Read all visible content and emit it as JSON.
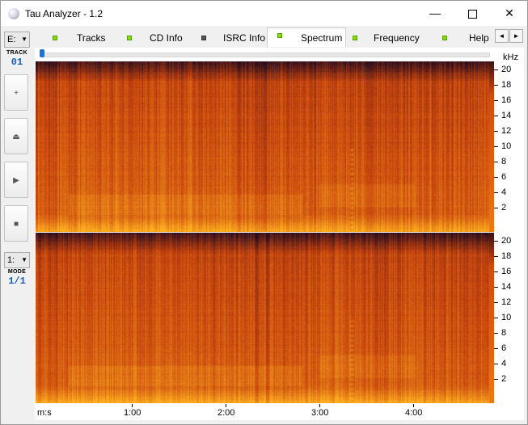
{
  "window": {
    "title": "Tau Analyzer - 1.2",
    "controls": {
      "minimize": "—",
      "close": "✕"
    }
  },
  "left_panel": {
    "drive": "E:",
    "track_caption": "TRACK",
    "track_number": "01",
    "buttons": [
      {
        "name": "zoom-in-button",
        "glyph": "plus-icon",
        "symbol": "+"
      },
      {
        "name": "eject-button",
        "glyph": "eject-icon",
        "symbol": "⏏"
      },
      {
        "name": "play-button",
        "glyph": "play-icon",
        "symbol": "▶"
      },
      {
        "name": "stop-button",
        "glyph": "stop-icon",
        "symbol": "■"
      }
    ],
    "mode_select": "1:",
    "mode_caption": "MODE",
    "mode_value": "1/1"
  },
  "tabs": [
    {
      "label": "Tracks",
      "led": "green",
      "active": false
    },
    {
      "label": "CD Info",
      "led": "green",
      "active": false
    },
    {
      "label": "ISRC Info",
      "led": "dark",
      "active": false
    },
    {
      "label": "Spectrum",
      "led": "green",
      "active": true
    },
    {
      "label": "Frequency",
      "led": "green",
      "active": false
    },
    {
      "label": "Help",
      "led": "green",
      "active": false
    }
  ],
  "tab_scroll": {
    "left": "◄",
    "right": "►"
  },
  "spectrum": {
    "unit": "kHz",
    "channels": 2,
    "y_ticks": [
      "20",
      "18",
      "16",
      "14",
      "12",
      "10",
      "8",
      "6",
      "4",
      "2"
    ],
    "x_ticks": [
      "m:s",
      "1:00",
      "2:00",
      "3:00",
      "4:00"
    ],
    "colors": {
      "low": "#2a0d1e",
      "mid": "#c8440e",
      "high": "#ffb020"
    }
  }
}
